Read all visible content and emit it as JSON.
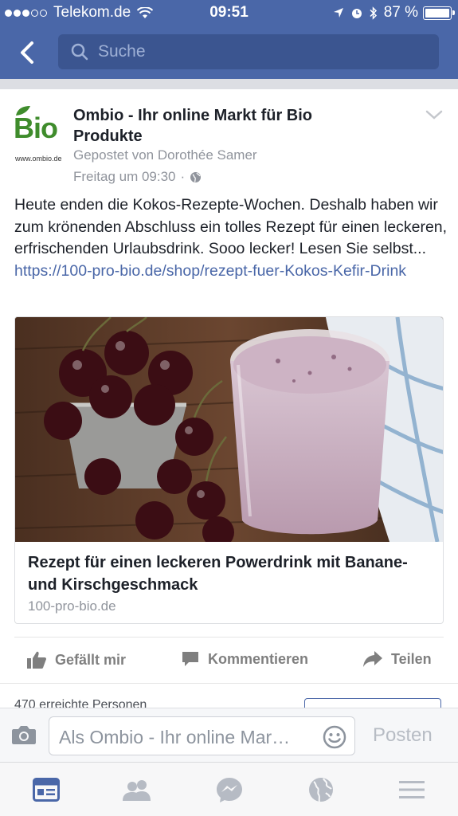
{
  "status_bar": {
    "carrier": "Telekom.de",
    "time": "09:51",
    "battery": "87 %"
  },
  "nav": {
    "search_placeholder": "Suche"
  },
  "post": {
    "page_name": "Ombio - Ihr online Markt für Bio Produkte",
    "avatar_logo_text": "Bio",
    "avatar_url_text": "www.ombio.de",
    "posted_by": "Gepostet von Dorothée Samer",
    "time": "Freitag um 09:30",
    "time_separator": "·",
    "text": "Heute enden die Kokos-Rezepte-Wochen. Deshalb haben wir zum krönenden Abschluss ein tolles Rezept für einen leckeren, erfrischenden Urlaubsdrink. Sooo lecker! Lesen Sie selbst... ",
    "link": "https://100-pro-bio.de/shop/rezept-fuer-Kokos-Kefir-Drink"
  },
  "link_card": {
    "title": "Rezept für einen leckeren Powerdrink mit Banane- und Kirschgeschmack",
    "domain": "100-pro-bio.de"
  },
  "actions": {
    "like": "Gefällt mir",
    "comment": "Kommentieren",
    "share": "Teilen"
  },
  "insights": {
    "reach": "470 erreichte Personen"
  },
  "composer": {
    "placeholder": "Als Ombio - Ihr online Mar…",
    "post_button": "Posten"
  },
  "colors": {
    "brand_blue": "#4a67a8",
    "search_bg": "#3b5590",
    "logo_green": "#3f8c2c",
    "muted": "#90949c"
  },
  "tabs": [
    "news-feed-icon",
    "friends-icon",
    "messenger-icon",
    "globe-icon",
    "menu-icon"
  ]
}
